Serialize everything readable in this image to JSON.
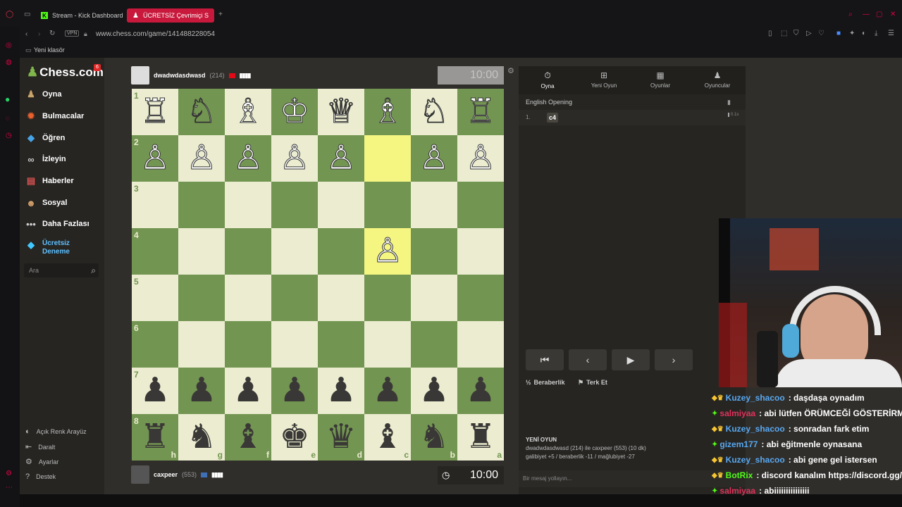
{
  "browser": {
    "tabs": [
      {
        "label": "Stream - Kick Dashboard"
      },
      {
        "label": "ÜCRETSİZ Çevrimiçi Satra"
      }
    ],
    "vpn": "VPN",
    "url": "www.chess.com/game/141488228054",
    "bookmark_folder": "Yeni klasör"
  },
  "sidebar": {
    "logo": "Chess.com",
    "logo_badge": "6",
    "items": [
      {
        "label": "Oyna"
      },
      {
        "label": "Bulmacalar"
      },
      {
        "label": "Öğren"
      },
      {
        "label": "İzleyin"
      },
      {
        "label": "Haberler"
      },
      {
        "label": "Sosyal"
      },
      {
        "label": "Daha Fazlası"
      },
      {
        "label": "Ücretsiz Deneme"
      }
    ],
    "search_placeholder": "Ara",
    "bottom": [
      {
        "label": "Açık Renk Arayüz"
      },
      {
        "label": "Daralt"
      },
      {
        "label": "Ayarlar"
      },
      {
        "label": "Destek"
      }
    ]
  },
  "game": {
    "top_player": {
      "name": "dwadwdasdwasd",
      "rating": "(214)"
    },
    "top_clock": "10:00",
    "bottom_player": {
      "name": "caxpeer",
      "rating": "(553)"
    },
    "bottom_clock": "10:00",
    "ranks": [
      "1",
      "2",
      "3",
      "4",
      "5",
      "6",
      "7",
      "8"
    ],
    "files": [
      "h",
      "g",
      "f",
      "e",
      "d",
      "c",
      "b",
      "a"
    ],
    "board": [
      [
        "♖",
        "♘",
        "♗",
        "♔",
        "♕",
        "♗",
        "♘",
        "♖"
      ],
      [
        "♙",
        "♙",
        "♙",
        "♙",
        "♙",
        "",
        "♙",
        "♙"
      ],
      [
        "",
        "",
        "",
        "",
        "",
        "",
        "",
        ""
      ],
      [
        "",
        "",
        "",
        "",
        "",
        "♙",
        "",
        ""
      ],
      [
        "",
        "",
        "",
        "",
        "",
        "",
        "",
        ""
      ],
      [
        "",
        "",
        "",
        "",
        "",
        "",
        "",
        ""
      ],
      [
        "♟",
        "♟",
        "♟",
        "♟",
        "♟",
        "♟",
        "♟",
        "♟"
      ],
      [
        "♜",
        "♞",
        "♝",
        "♚",
        "♛",
        "♝",
        "♞",
        "♜"
      ]
    ],
    "board_colors": {
      "light": "#ebecd0",
      "dark": "#739552",
      "highlight": "#f5f682"
    }
  },
  "panel": {
    "tabs": [
      {
        "label": "Oyna",
        "icon": "stopwatch-icon"
      },
      {
        "label": "Yeni Oyun",
        "icon": "plus-box-icon"
      },
      {
        "label": "Oyunlar",
        "icon": "board-icon"
      },
      {
        "label": "Oyuncular",
        "icon": "players-icon"
      }
    ],
    "opening": "English Opening",
    "move_number": "1.",
    "move": "c4",
    "move_time": "0.1s",
    "draw_label": "Beraberlik",
    "resign_label": "Terk Et",
    "new_game_title": "YENİ OYUN",
    "new_game_line1": "dwadwdasdwasd (214) ile caxpeer (553) (10 dk)",
    "new_game_line2": "galibiyet +5 / beraberlik -11 / mağlubiyet -27",
    "message_placeholder": "Bir mesaj yollayın..."
  },
  "chat": [
    {
      "user": "Kuzey_shacoo",
      "color": "#58a8f0",
      "text": ": daşdaşa oynadım"
    },
    {
      "user": "salmiyaa",
      "color": "#e0315a",
      "text": ": abi lütfen ÖRÜMCEĞİ GÖSTERİRMİ"
    },
    {
      "user": "Kuzey_shacoo",
      "color": "#58a8f0",
      "text": ": sonradan fark etim"
    },
    {
      "user": "gizem177",
      "color": "#58a8f0",
      "text": ": abi eğitmenle oynasana"
    },
    {
      "user": "Kuzey_shacoo",
      "color": "#58a8f0",
      "text": ": abi gene gel istersen"
    },
    {
      "user": "BotRix",
      "color": "#53fc18",
      "text": ": discord kanalım https://discord.gg/"
    },
    {
      "user": "salmiyaa",
      "color": "#e0315a",
      "text": ": abiiiiiiiiiiiiiii"
    }
  ]
}
